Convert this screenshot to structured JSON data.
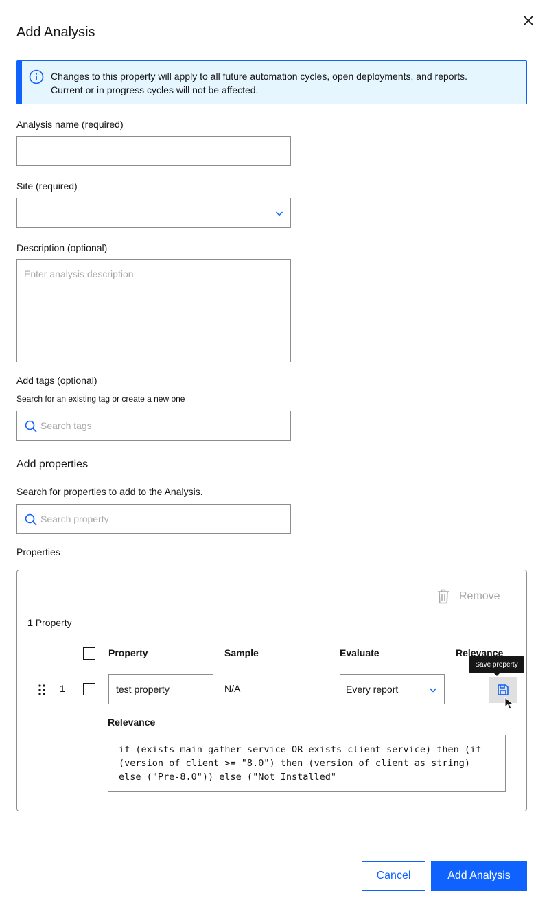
{
  "dialog": {
    "title": "Add Analysis",
    "close_icon": "close-icon"
  },
  "banner": {
    "icon": "info-icon",
    "line1": "Changes to this property will apply to all future automation cycles, open deployments, and reports.",
    "line2": "Current or in progress cycles will not be affected."
  },
  "form": {
    "name_label": "Analysis name (required)",
    "name_value": "",
    "site_label": "Site (required)",
    "site_value": "",
    "description_label": "Description (optional)",
    "description_placeholder": "Enter analysis description",
    "tags_label": "Add tags (optional)",
    "tags_helper": "Search for an existing tag or create a new one",
    "tags_placeholder": "Search tags"
  },
  "properties_section": {
    "title": "Add properties",
    "helper": "Search for properties to add to the Analysis.",
    "search_placeholder": "Search property",
    "list_label": "Properties",
    "remove_label": "Remove",
    "count_number": "1",
    "count_label": "Property",
    "columns": [
      "Property",
      "Sample",
      "Evaluate",
      "Relevance"
    ],
    "rows": [
      {
        "index": "1",
        "property": "test property",
        "sample": "N/A",
        "evaluate": "Every report",
        "relevance_label": "Relevance",
        "relevance": "if (exists main gather service OR exists client service) then (if (version of client >= \"8.0\") then (version of client as string) else (\"Pre-8.0\")) else (\"Not Installed\""
      }
    ],
    "save_tooltip": "Save property"
  },
  "footer": {
    "cancel_label": "Cancel",
    "submit_label": "Add Analysis"
  },
  "colors": {
    "accent": "#0f62fe",
    "banner_bg": "#e5f6ff",
    "border": "#8d8d8d",
    "text": "#161616"
  }
}
